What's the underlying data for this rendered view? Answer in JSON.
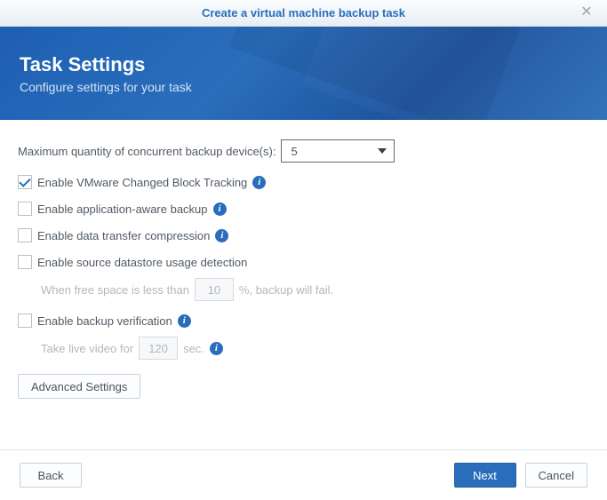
{
  "window": {
    "title": "Create a virtual machine backup task"
  },
  "banner": {
    "heading": "Task Settings",
    "subheading": "Configure settings for your task"
  },
  "form": {
    "max_label": "Maximum quantity of concurrent backup device(s):",
    "max_value": "5",
    "cbt": {
      "label": "Enable VMware Changed Block Tracking",
      "checked": true
    },
    "appaware": {
      "label": "Enable application-aware backup",
      "checked": false
    },
    "compress": {
      "label": "Enable data transfer compression",
      "checked": false
    },
    "datastore": {
      "label": "Enable source datastore usage detection",
      "checked": false,
      "sub_prefix": "When free space is less than",
      "sub_value": "10",
      "sub_suffix": "%, backup will fail."
    },
    "verify": {
      "label": "Enable backup verification",
      "checked": false,
      "sub_prefix": "Take live video for",
      "sub_value": "120",
      "sub_suffix": "sec."
    },
    "advanced_btn": "Advanced Settings"
  },
  "footer": {
    "back": "Back",
    "next": "Next",
    "cancel": "Cancel"
  }
}
